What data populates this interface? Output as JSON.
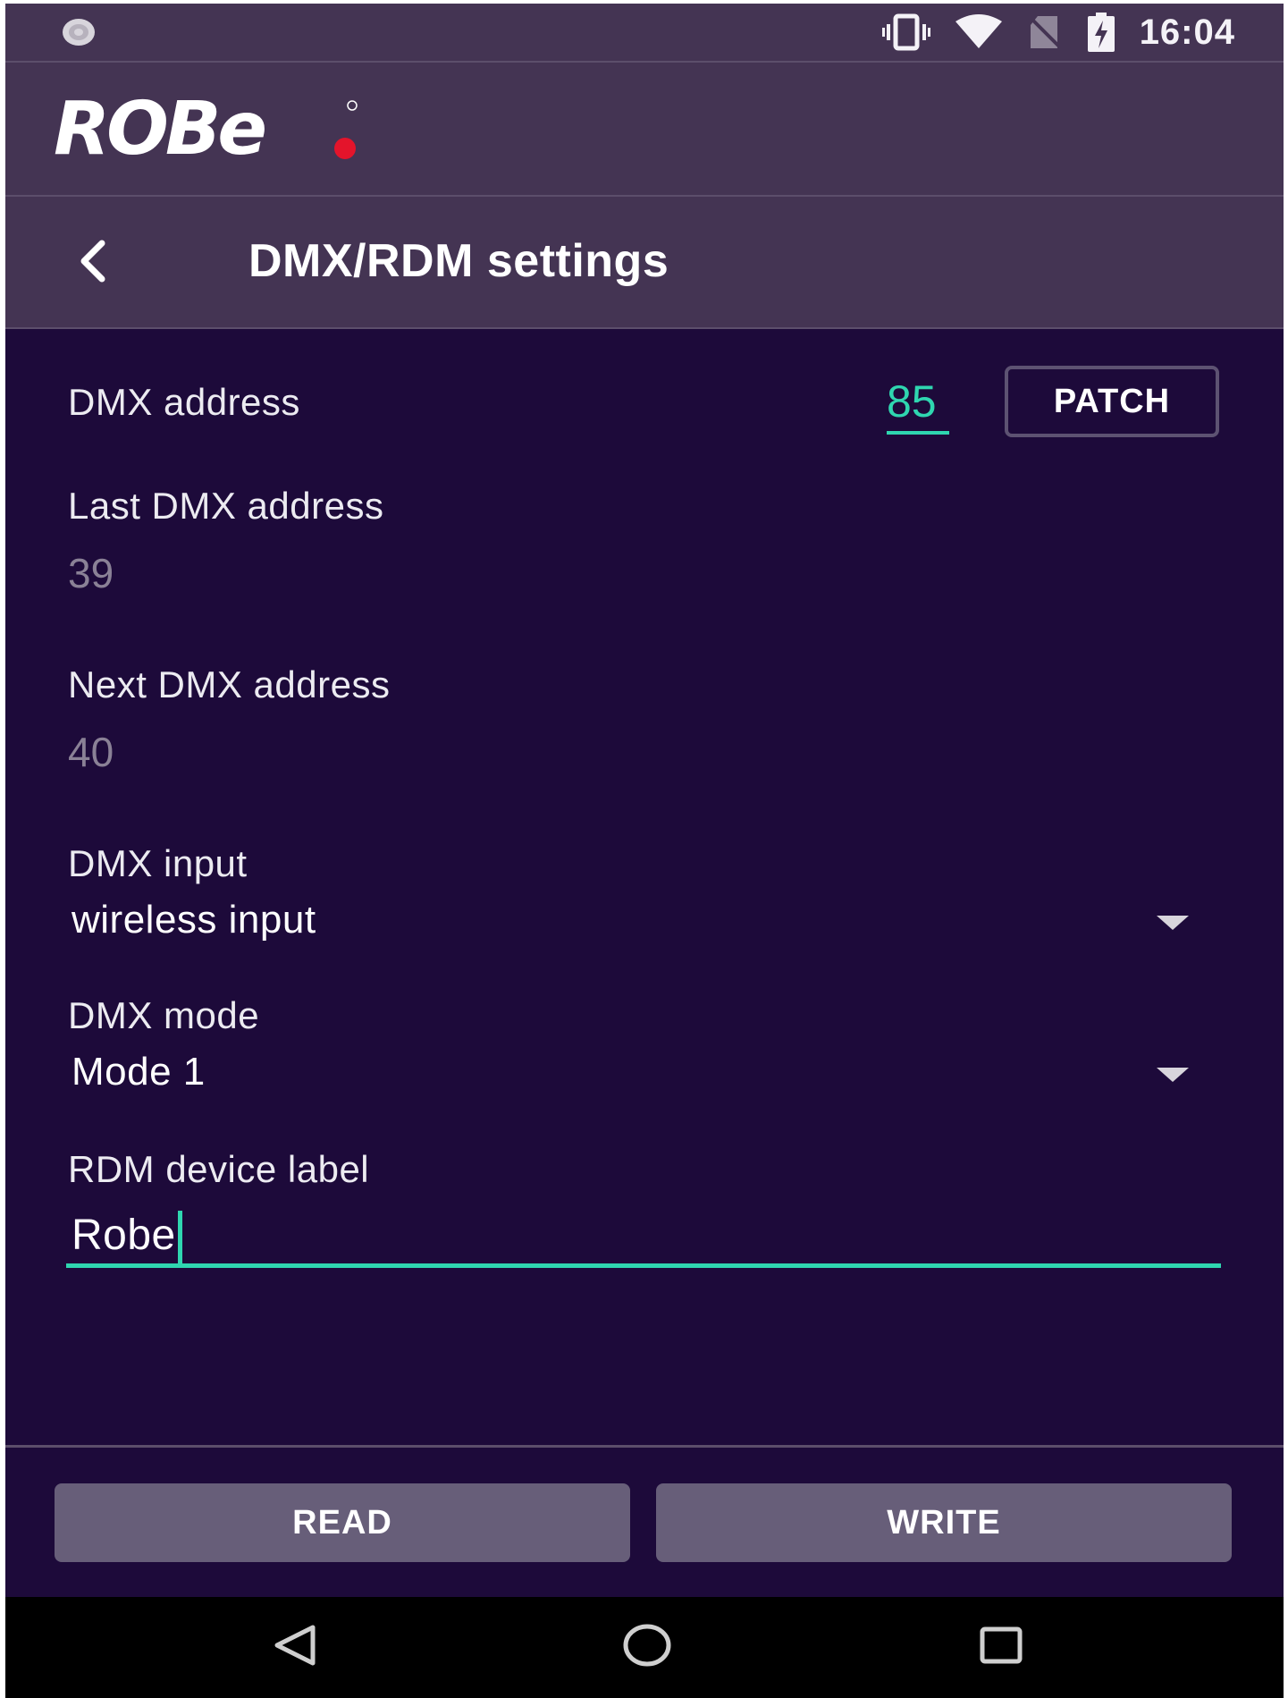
{
  "status_bar": {
    "time": "16:04",
    "icons": [
      "settings-gear-icon",
      "vibrate-icon",
      "wifi-icon",
      "no-sim-icon",
      "battery-charging-icon"
    ]
  },
  "brand": {
    "logo_text": "ROBE",
    "logo_dot_color": "#e4142b"
  },
  "header": {
    "title": "DMX/RDM settings",
    "back_icon": "chevron-left-icon"
  },
  "dmx_address": {
    "label": "DMX address",
    "value": "85",
    "patch_label": "PATCH"
  },
  "last_dmx_address": {
    "label": "Last DMX address",
    "value": "39"
  },
  "next_dmx_address": {
    "label": "Next DMX address",
    "value": "40"
  },
  "dmx_input": {
    "label": "DMX input",
    "selected": "wireless input"
  },
  "dmx_mode": {
    "label": "DMX mode",
    "selected": "Mode 1"
  },
  "rdm_device_label": {
    "label": "RDM device label",
    "value": "Robe"
  },
  "actions": {
    "read_label": "READ",
    "write_label": "WRITE"
  },
  "nav": {
    "icons": [
      "back-triangle-icon",
      "home-circle-icon",
      "recents-square-icon"
    ]
  },
  "colors": {
    "accent": "#2fd6b0",
    "background": "#1d0a3a",
    "header": "#443453",
    "button": "#675e79"
  }
}
